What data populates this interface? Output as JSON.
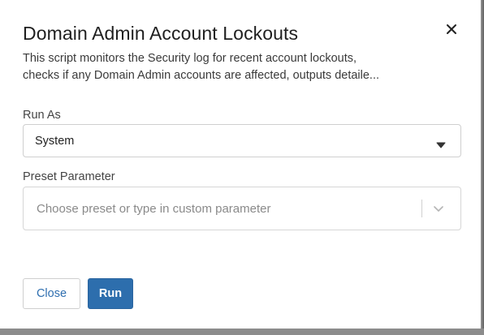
{
  "dialog": {
    "title": "Domain Admin Account Lockouts",
    "description_line1": "This script monitors the Security log for recent account lockouts,",
    "description_line2": "checks if any Domain Admin accounts are affected, outputs detaile..."
  },
  "run_as": {
    "label": "Run As",
    "selected": "System"
  },
  "preset_parameter": {
    "label": "Preset Parameter",
    "placeholder": "Choose preset or type in custom parameter",
    "value": ""
  },
  "buttons": {
    "close_label": "Close",
    "run_label": "Run"
  },
  "colors": {
    "primary": "#2d6ead",
    "link": "#2f6fb0",
    "border": "#cfcfcf"
  },
  "icons": {
    "close": "close-icon",
    "caret": "caret-down-icon",
    "chevron": "chevron-down-icon"
  }
}
